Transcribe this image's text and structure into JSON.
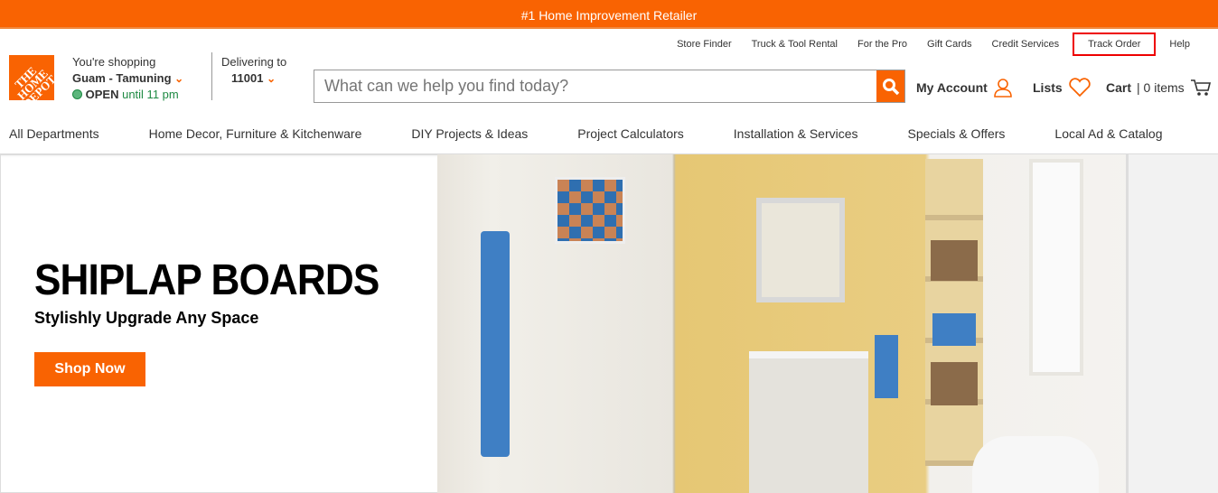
{
  "banner": {
    "text": "#1 Home Improvement Retailer"
  },
  "utility_links": [
    "Store Finder",
    "Truck & Tool Rental",
    "For the Pro",
    "Gift Cards",
    "Credit Services",
    "Track Order",
    "Help"
  ],
  "logo": {
    "text": "THE HOME DEPOT"
  },
  "store": {
    "label": "You're shopping",
    "name": "Guam - Tamuning",
    "status": "OPEN",
    "hours": "until 11 pm"
  },
  "delivery": {
    "label": "Delivering to",
    "zip": "11001"
  },
  "search": {
    "placeholder": "What can we help you find today?"
  },
  "header": {
    "account": "My Account",
    "lists": "Lists",
    "cart": "Cart",
    "cart_count": "0 items"
  },
  "nav": [
    "All Departments",
    "Home Decor, Furniture & Kitchenware",
    "DIY Projects & Ideas",
    "Project Calculators",
    "Installation & Services",
    "Specials & Offers",
    "Local Ad & Catalog"
  ],
  "hero": {
    "title": "SHIPLAP BOARDS",
    "subtitle": "Stylishly Upgrade Any Space",
    "cta": "Shop Now"
  },
  "colors": {
    "brand": "#f96302",
    "open": "#1e8a43",
    "highlight": "#e00000"
  }
}
